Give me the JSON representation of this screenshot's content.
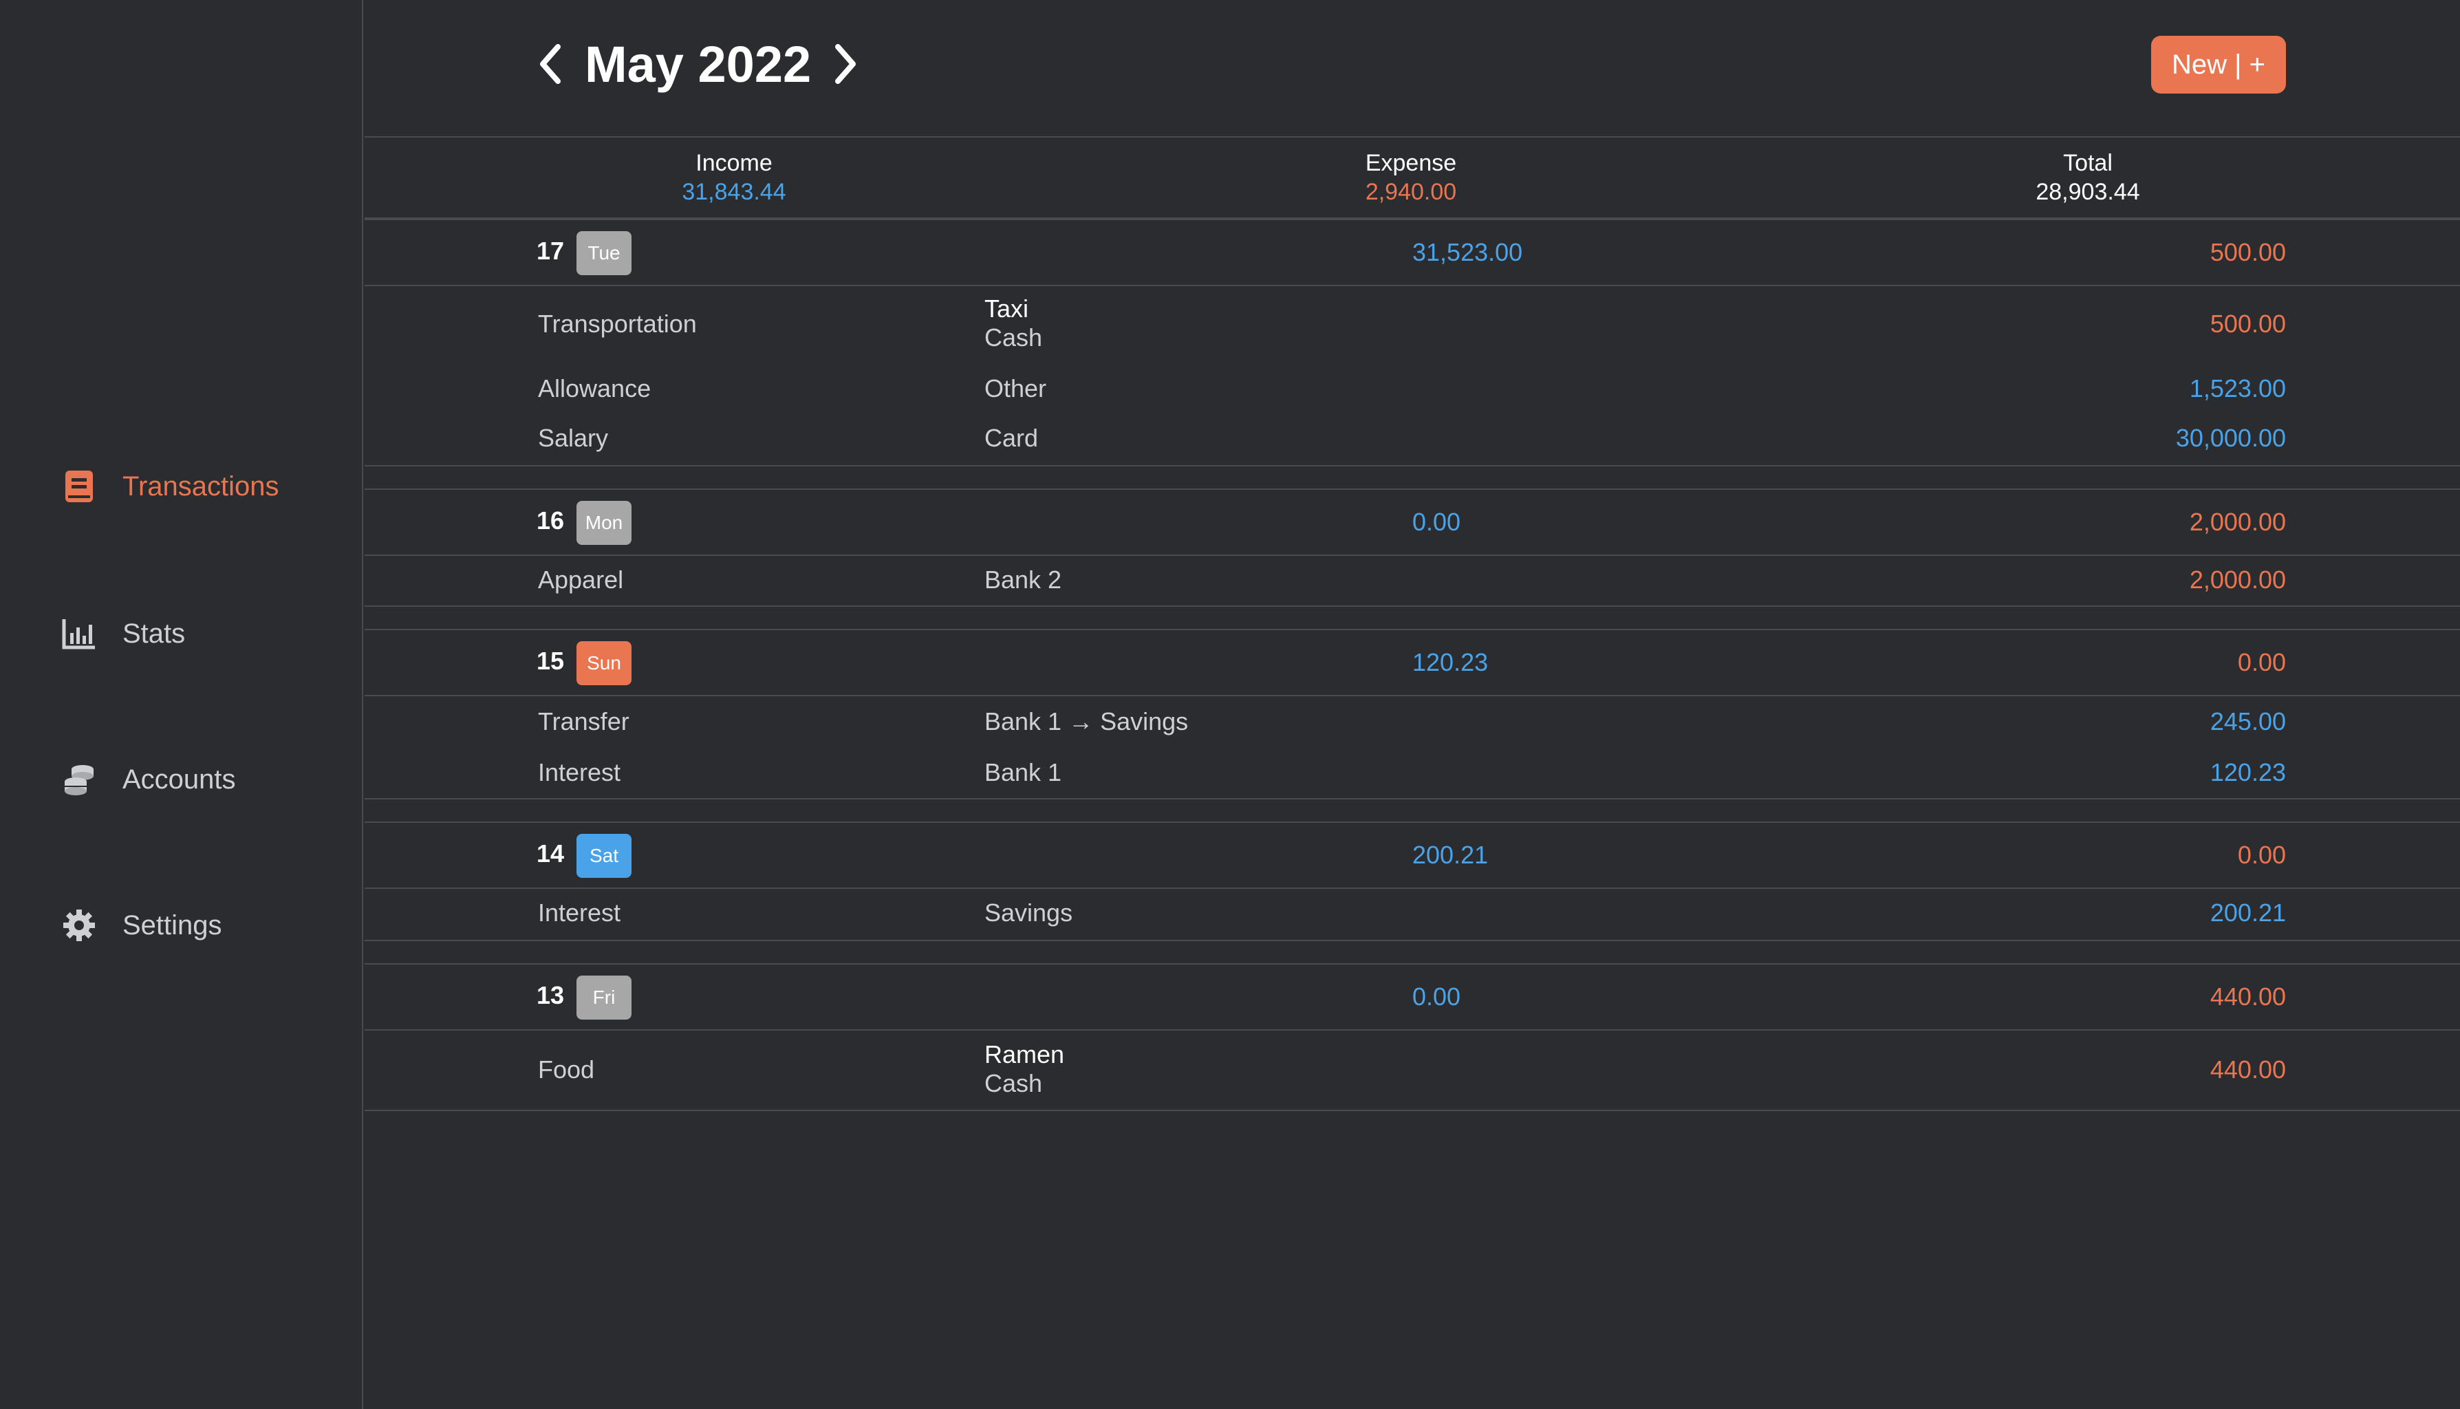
{
  "sidebar": {
    "items": [
      {
        "label": "Transactions",
        "icon": "book-icon"
      },
      {
        "label": "Stats",
        "icon": "bar-chart-icon"
      },
      {
        "label": "Accounts",
        "icon": "coins-icon"
      },
      {
        "label": "Settings",
        "icon": "gear-icon"
      }
    ]
  },
  "header": {
    "month": "May 2022",
    "new_button": "New | +"
  },
  "summary": {
    "income_label": "Income",
    "income_value": "31,843.44",
    "expense_label": "Expense",
    "expense_value": "2,940.00",
    "total_label": "Total",
    "total_value": "28,903.44"
  },
  "days": [
    {
      "num": "17",
      "weekday": "Tue",
      "income": "31,523.00",
      "expense": "500.00",
      "tx": [
        {
          "category": "Transportation",
          "note": "Taxi",
          "account": "Cash",
          "amount": "500.00"
        },
        {
          "category": "Allowance",
          "account": "Other",
          "amount": "1,523.00"
        },
        {
          "category": "Salary",
          "account": "Card",
          "amount": "30,000.00"
        }
      ]
    },
    {
      "num": "16",
      "weekday": "Mon",
      "income": "0.00",
      "expense": "2,000.00",
      "tx": [
        {
          "category": "Apparel",
          "account": "Bank 2",
          "amount": "2,000.00"
        }
      ]
    },
    {
      "num": "15",
      "weekday": "Sun",
      "income": "120.23",
      "expense": "0.00",
      "tx": [
        {
          "category": "Transfer",
          "account": "Bank 1 → Savings",
          "amount": "245.00"
        },
        {
          "category": "Interest",
          "account": "Bank 1",
          "amount": "120.23"
        }
      ]
    },
    {
      "num": "14",
      "weekday": "Sat",
      "income": "200.21",
      "expense": "0.00",
      "tx": [
        {
          "category": "Interest",
          "account": "Savings",
          "amount": "200.21"
        }
      ]
    },
    {
      "num": "13",
      "weekday": "Fri",
      "income": "0.00",
      "expense": "440.00",
      "tx": [
        {
          "category": "Food",
          "note": "Ramen",
          "account": "Cash",
          "amount": "440.00"
        }
      ]
    }
  ],
  "colors": {
    "accent": "#e97650",
    "income": "#4aa3e8",
    "background": "#2b2c2f",
    "badge_weekday": "#a7a7a7",
    "badge_sunday": "#e97650",
    "badge_saturday": "#4aa3e8"
  }
}
